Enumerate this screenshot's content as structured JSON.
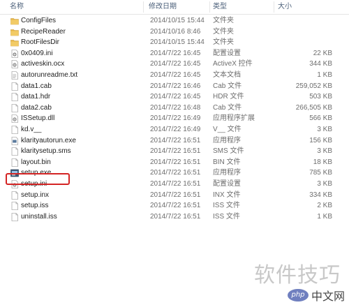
{
  "header": {
    "name": "名称",
    "date": "修改日期",
    "type": "类型",
    "size": "大小"
  },
  "files": [
    {
      "name": "ConfigFiles",
      "date": "2014/10/15 15:44",
      "type": "文件夹",
      "size": "",
      "icon": "folder-icon"
    },
    {
      "name": "RecipeReader",
      "date": "2014/10/16 8:46",
      "type": "文件夹",
      "size": "",
      "icon": "folder-icon"
    },
    {
      "name": "RootFilesDir",
      "date": "2014/10/15 15:44",
      "type": "文件夹",
      "size": "",
      "icon": "folder-icon"
    },
    {
      "name": "0x0409.ini",
      "date": "2014/7/22 16:45",
      "type": "配置设置",
      "size": "22 KB",
      "icon": "settings-file-icon"
    },
    {
      "name": "activeskin.ocx",
      "date": "2014/7/22 16:45",
      "type": "ActiveX 控件",
      "size": "344 KB",
      "icon": "activex-file-icon"
    },
    {
      "name": "autorunreadme.txt",
      "date": "2014/7/22 16:45",
      "type": "文本文档",
      "size": "1 KB",
      "icon": "text-file-icon"
    },
    {
      "name": "data1.cab",
      "date": "2014/7/22 16:46",
      "type": "Cab 文件",
      "size": "259,052 KB",
      "icon": "file-icon"
    },
    {
      "name": "data1.hdr",
      "date": "2014/7/22 16:45",
      "type": "HDR 文件",
      "size": "503 KB",
      "icon": "file-icon"
    },
    {
      "name": "data2.cab",
      "date": "2014/7/22 16:48",
      "type": "Cab 文件",
      "size": "266,505 KB",
      "icon": "file-icon"
    },
    {
      "name": "ISSetup.dll",
      "date": "2014/7/22 16:49",
      "type": "应用程序扩展",
      "size": "566 KB",
      "icon": "dll-file-icon"
    },
    {
      "name": "kd.v__",
      "date": "2014/7/22 16:49",
      "type": "V__ 文件",
      "size": "3 KB",
      "icon": "file-icon"
    },
    {
      "name": "klarityautorun.exe",
      "date": "2014/7/22 16:51",
      "type": "应用程序",
      "size": "156 KB",
      "icon": "exe-file-icon"
    },
    {
      "name": "klaritysetup.sms",
      "date": "2014/7/22 16:51",
      "type": "SMS 文件",
      "size": "3 KB",
      "icon": "file-icon"
    },
    {
      "name": "layout.bin",
      "date": "2014/7/22 16:51",
      "type": "BIN 文件",
      "size": "18 KB",
      "icon": "file-icon"
    },
    {
      "name": "setup.exe",
      "date": "2014/7/22 16:51",
      "type": "应用程序",
      "size": "785 KB",
      "icon": "setup-exe-icon"
    },
    {
      "name": "setup.ini",
      "date": "2014/7/22 16:51",
      "type": "配置设置",
      "size": "3 KB",
      "icon": "settings-file-icon"
    },
    {
      "name": "setup.inx",
      "date": "2014/7/22 16:51",
      "type": "INX 文件",
      "size": "334 KB",
      "icon": "file-icon"
    },
    {
      "name": "setup.iss",
      "date": "2014/7/22 16:51",
      "type": "ISS 文件",
      "size": "2 KB",
      "icon": "file-icon"
    },
    {
      "name": "uninstall.iss",
      "date": "2014/7/22 16:51",
      "type": "ISS 文件",
      "size": "1 KB",
      "icon": "file-icon"
    }
  ],
  "highlighted_file": "setup.exe",
  "watermark": "软件技巧",
  "badge": {
    "logo": "php",
    "text": "中文网"
  },
  "colors": {
    "folder": "#e8b84a",
    "highlight": "#d42424",
    "header_text": "#4c607a"
  }
}
